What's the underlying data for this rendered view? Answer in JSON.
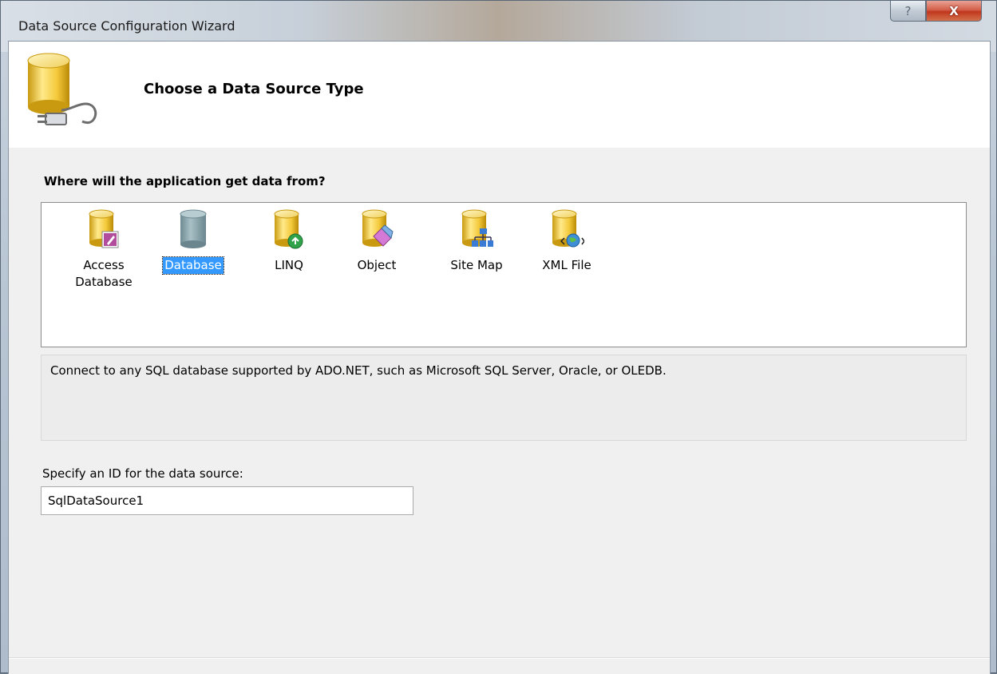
{
  "window": {
    "title": "Data Source Configuration Wizard",
    "help_glyph": "?",
    "close_glyph": "X"
  },
  "header": {
    "title": "Choose a Data Source Type",
    "icon": "database-plug-icon"
  },
  "question": "Where will the application get data from?",
  "sources": [
    {
      "label": "Access Database",
      "icon": "access-database-icon",
      "selected": false
    },
    {
      "label": "Database",
      "icon": "database-icon",
      "selected": true
    },
    {
      "label": "LINQ",
      "icon": "linq-icon",
      "selected": false
    },
    {
      "label": "Object",
      "icon": "object-icon",
      "selected": false
    },
    {
      "label": "Site Map",
      "icon": "site-map-icon",
      "selected": false
    },
    {
      "label": "XML File",
      "icon": "xml-file-icon",
      "selected": false
    }
  ],
  "description": "Connect to any SQL database supported by ADO.NET, such as Microsoft SQL Server, Oracle, or OLEDB.",
  "id_field": {
    "label": "Specify an ID for the data source:",
    "value": "SqlDataSource1"
  },
  "colors": {
    "selection": "#3399ff",
    "cylinder_gold": "#f2c94c",
    "cylinder_blue": "#8fa9b3"
  }
}
